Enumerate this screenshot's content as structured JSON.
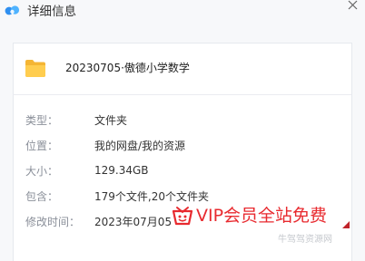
{
  "window": {
    "title": "详细信息"
  },
  "header": {
    "name": "20230705·傲德小学数学"
  },
  "details": [
    {
      "label": "类型：",
      "value": "文件夹"
    },
    {
      "label": "位置：",
      "value": "我的网盘/我的资源"
    },
    {
      "label": "大小：",
      "value": "129.34GB"
    },
    {
      "label": "包含：",
      "value": "179个文件,20个文件夹"
    },
    {
      "label": "修改时间：",
      "value": "2023年07月05"
    }
  ],
  "overlay": {
    "banner": "VIP会员全站免费",
    "watermark": "牛驾驾资源网"
  },
  "colors": {
    "accent": "#e82a2f",
    "folder": "#f7c24a",
    "app_icon": "#3a9bf5"
  }
}
